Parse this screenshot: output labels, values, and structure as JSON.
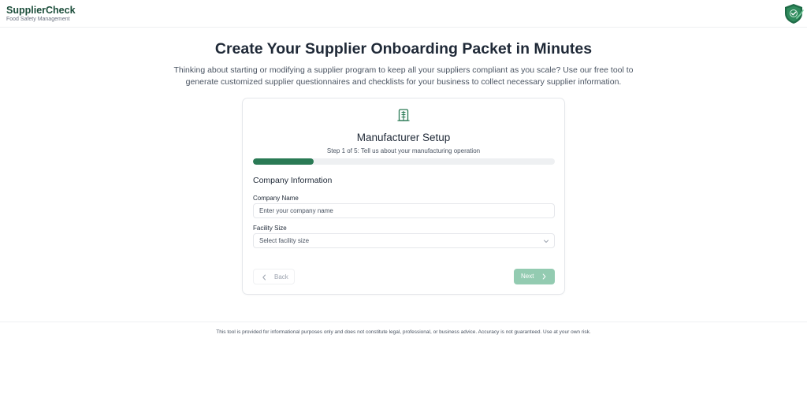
{
  "header": {
    "brand_name": "SupplierCheck",
    "brand_tagline": "Food Safety Management",
    "logo_icon": "shield-check-icon",
    "brand_color": "#1b4d3a"
  },
  "hero": {
    "title": "Create Your Supplier Onboarding Packet in Minutes",
    "description": "Thinking about starting or modifying a supplier program to keep all your suppliers compliant as you scale? Use our free tool to generate customized supplier questionnaires and checklists for your business to collect necessary supplier information."
  },
  "wizard": {
    "icon": "building-icon",
    "title": "Manufacturer Setup",
    "step_text": "Step 1 of 5: Tell us about your manufacturing operation",
    "progress_fraction": 0.2,
    "accent_color": "#2a7a55",
    "section_title": "Company Information",
    "company_name": {
      "label": "Company Name",
      "placeholder": "Enter your company name",
      "value": ""
    },
    "facility_size": {
      "label": "Facility Size",
      "placeholder": "Select facility size"
    },
    "back_label": "Back",
    "next_label": "Next",
    "next_color": "#93cbb1"
  },
  "footer": {
    "disclaimer": "This tool is provided for informational purposes only and does not constitute legal, professional, or business advice. Accuracy is not guaranteed. Use at your own risk."
  }
}
